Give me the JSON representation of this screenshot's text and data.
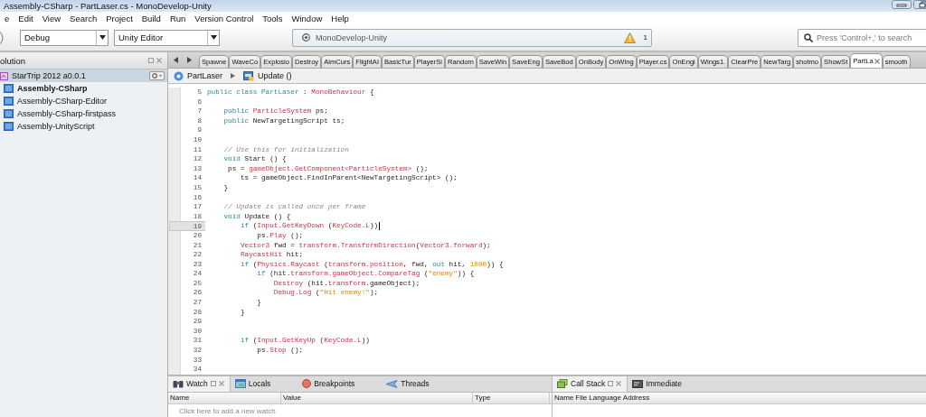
{
  "window": {
    "title": "Assembly-CSharp - PartLaser.cs - MonoDevelop-Unity"
  },
  "menu": [
    "e",
    "Edit",
    "View",
    "Search",
    "Project",
    "Build",
    "Run",
    "Version Control",
    "Tools",
    "Window",
    "Help"
  ],
  "toolbar": {
    "configuration": "Debug",
    "target": "Unity Editor",
    "status": "MonoDevelop-Unity",
    "warnings": "1",
    "search": {
      "placeholder": "Press 'Control+,' to search"
    }
  },
  "solution": {
    "title": "olution",
    "items": [
      {
        "label": "StarTrip 2012 a0.0.1",
        "selected": true,
        "startup": false,
        "children": [
          {
            "label": "Assembly-CSharp",
            "selected": false,
            "startup": true
          },
          {
            "label": "Assembly-CSharp-Editor",
            "selected": false,
            "startup": false
          },
          {
            "label": "Assembly-CSharp-firstpass",
            "selected": false,
            "startup": false
          },
          {
            "label": "Assembly-UnityScript",
            "selected": false,
            "startup": false
          }
        ]
      }
    ]
  },
  "tabs": [
    {
      "label": "Spawne",
      "selected": false
    },
    {
      "label": "WaveCo",
      "selected": false
    },
    {
      "label": "Explosio",
      "selected": false
    },
    {
      "label": "Destroy",
      "selected": false
    },
    {
      "label": "AimCurs",
      "selected": false
    },
    {
      "label": "FlightAI",
      "selected": false
    },
    {
      "label": "BasicTur",
      "selected": false
    },
    {
      "label": "PlayerSi",
      "selected": false
    },
    {
      "label": "Random",
      "selected": false
    },
    {
      "label": "SaveWin",
      "selected": false
    },
    {
      "label": "SaveEng",
      "selected": false
    },
    {
      "label": "SaveBod",
      "selected": false
    },
    {
      "label": "OnBody",
      "selected": false
    },
    {
      "label": "OnWing",
      "selected": false
    },
    {
      "label": "Player.cs",
      "selected": false
    },
    {
      "label": "OnEngi",
      "selected": false
    },
    {
      "label": "Wings1.",
      "selected": false
    },
    {
      "label": "ClearPre",
      "selected": false
    },
    {
      "label": "NewTarg",
      "selected": false
    },
    {
      "label": "shotmo",
      "selected": false
    },
    {
      "label": "ShowSt",
      "selected": false
    },
    {
      "label": "PartLa",
      "selected": true
    },
    {
      "label": "smooth",
      "selected": false
    }
  ],
  "breadcrumb": [
    {
      "kind": "class",
      "label": "PartLaser"
    },
    {
      "kind": "method",
      "label": "Update ()"
    }
  ],
  "editor": {
    "lines": [
      {
        "number": "5",
        "current": false,
        "tokens": [
          {
            "kind": "keyword",
            "text": "public class PartLaser"
          },
          {
            "kind": "plain",
            "text": " : "
          },
          {
            "kind": "type",
            "text": "MonoBehaviour"
          },
          {
            "kind": "plain",
            "text": " {"
          }
        ]
      },
      {
        "number": "6",
        "current": false
      },
      {
        "number": "7",
        "current": false,
        "tokens": [
          {
            "kind": "keyword",
            "text": "    public "
          },
          {
            "kind": "type",
            "text": "ParticleSystem"
          },
          {
            "kind": "plain",
            "text": " ps;"
          }
        ]
      },
      {
        "number": "8",
        "current": false,
        "tokens": [
          {
            "kind": "keyword",
            "text": "    public "
          },
          {
            "kind": "plain",
            "text": "NewTargetingScript ts;"
          }
        ]
      },
      {
        "number": "9",
        "current": false
      },
      {
        "number": "10",
        "current": false
      },
      {
        "number": "11",
        "current": false,
        "tokens": [
          {
            "kind": "comment",
            "text": "    // Use this for initialization"
          }
        ]
      },
      {
        "number": "12",
        "current": false,
        "tokens": [
          {
            "kind": "keyword",
            "text": "    void "
          },
          {
            "kind": "plain",
            "text": "Start () {"
          }
        ]
      },
      {
        "number": "13",
        "current": false,
        "tokens": [
          {
            "kind": "plain",
            "text": "     ps = "
          },
          {
            "kind": "type",
            "text": "gameObject.GetComponent<ParticleSystem>"
          },
          {
            "kind": "plain",
            "text": " ();"
          }
        ]
      },
      {
        "number": "14",
        "current": false,
        "tokens": [
          {
            "kind": "plain",
            "text": "        ts = gameObject.FindInParent<NewTargetingScript> ();"
          }
        ]
      },
      {
        "number": "15",
        "current": false,
        "tokens": [
          {
            "kind": "plain",
            "text": "    }"
          }
        ]
      },
      {
        "number": "16",
        "current": false
      },
      {
        "number": "17",
        "current": false,
        "tokens": [
          {
            "kind": "comment",
            "text": "    // Update is called once per frame"
          }
        ]
      },
      {
        "number": "18",
        "current": false,
        "tokens": [
          {
            "kind": "keyword",
            "text": "    void "
          },
          {
            "kind": "plain",
            "text": "Update () {"
          }
        ]
      },
      {
        "number": "19",
        "current": true,
        "tokens": [
          {
            "kind": "keyword",
            "text": "        if "
          },
          {
            "kind": "plain",
            "text": "("
          },
          {
            "kind": "type",
            "text": "Input.GetKeyDown"
          },
          {
            "kind": "plain",
            "text": " ("
          },
          {
            "kind": "type",
            "text": "KeyCode.L"
          },
          {
            "kind": "plain",
            "text": "))"
          }
        ]
      },
      {
        "number": "20",
        "current": false,
        "tokens": [
          {
            "kind": "plain",
            "text": "            ps."
          },
          {
            "kind": "type",
            "text": "Play"
          },
          {
            "kind": "plain",
            "text": " ();"
          }
        ]
      },
      {
        "number": "21",
        "current": false,
        "tokens": [
          {
            "kind": "type",
            "text": "        Vector3"
          },
          {
            "kind": "plain",
            "text": " fwd = "
          },
          {
            "kind": "type",
            "text": "transform.TransformDirection"
          },
          {
            "kind": "plain",
            "text": "("
          },
          {
            "kind": "type",
            "text": "Vector3.forward"
          },
          {
            "kind": "plain",
            "text": ");"
          }
        ]
      },
      {
        "number": "22",
        "current": false,
        "tokens": [
          {
            "kind": "type",
            "text": "        RaycastHit"
          },
          {
            "kind": "plain",
            "text": " hit;"
          }
        ]
      },
      {
        "number": "23",
        "current": false,
        "tokens": [
          {
            "kind": "keyword",
            "text": "        if "
          },
          {
            "kind": "plain",
            "text": "("
          },
          {
            "kind": "type",
            "text": "Physics.Raycast"
          },
          {
            "kind": "plain",
            "text": " ("
          },
          {
            "kind": "type",
            "text": "transform.position"
          },
          {
            "kind": "plain",
            "text": ", fwd, "
          },
          {
            "kind": "keyword",
            "text": "out "
          },
          {
            "kind": "plain",
            "text": "hit, "
          },
          {
            "kind": "number",
            "text": "1000"
          },
          {
            "kind": "plain",
            "text": ")) {"
          }
        ]
      },
      {
        "number": "24",
        "current": false,
        "tokens": [
          {
            "kind": "keyword",
            "text": "            if "
          },
          {
            "kind": "plain",
            "text": "(hit."
          },
          {
            "kind": "type",
            "text": "transform.gameObject.CompareTag"
          },
          {
            "kind": "plain",
            "text": " ("
          },
          {
            "kind": "string",
            "text": "\"enemy\""
          },
          {
            "kind": "plain",
            "text": ")) {"
          }
        ]
      },
      {
        "number": "25",
        "current": false,
        "tokens": [
          {
            "kind": "type",
            "text": "                Destroy"
          },
          {
            "kind": "plain",
            "text": " (hit."
          },
          {
            "kind": "type",
            "text": "transform"
          },
          {
            "kind": "plain",
            "text": ".gameObject);"
          }
        ]
      },
      {
        "number": "26",
        "current": false,
        "tokens": [
          {
            "kind": "type",
            "text": "                Debug.Log"
          },
          {
            "kind": "plain",
            "text": " ("
          },
          {
            "kind": "string",
            "text": "\"Hit enemy!\""
          },
          {
            "kind": "plain",
            "text": ");"
          }
        ]
      },
      {
        "number": "27",
        "current": false,
        "tokens": [
          {
            "kind": "plain",
            "text": "            }"
          }
        ]
      },
      {
        "number": "28",
        "current": false,
        "tokens": [
          {
            "kind": "plain",
            "text": "        }"
          }
        ]
      },
      {
        "number": "29",
        "current": false
      },
      {
        "number": "30",
        "current": false
      },
      {
        "number": "31",
        "current": false,
        "tokens": [
          {
            "kind": "keyword",
            "text": "        if "
          },
          {
            "kind": "plain",
            "text": "("
          },
          {
            "kind": "type",
            "text": "Input.GetKeyUp"
          },
          {
            "kind": "plain",
            "text": " ("
          },
          {
            "kind": "type",
            "text": "KeyCode.L"
          },
          {
            "kind": "plain",
            "text": "))"
          }
        ]
      },
      {
        "number": "32",
        "current": false,
        "tokens": [
          {
            "kind": "plain",
            "text": "            ps."
          },
          {
            "kind": "type",
            "text": "Stop"
          },
          {
            "kind": "plain",
            "text": " ();"
          }
        ]
      },
      {
        "number": "33",
        "current": false
      },
      {
        "number": "34",
        "current": false
      }
    ]
  },
  "watch": {
    "tabs": [
      {
        "kind": "watch",
        "label": "Watch",
        "selected": true
      },
      {
        "kind": "locals",
        "label": "Locals",
        "selected": false
      },
      {
        "kind": "breakpoints",
        "label": "Breakpoints",
        "selected": false
      },
      {
        "kind": "threads",
        "label": "Threads",
        "selected": false
      }
    ],
    "columns": [
      "Name",
      "Value",
      "Type"
    ],
    "hint_row": "Click here to add a new watch"
  },
  "callstack": {
    "tabs": [
      {
        "kind": "callstack",
        "label": "Call Stack",
        "selected": true
      },
      {
        "kind": "immediate",
        "label": "Immediate",
        "selected": false
      }
    ],
    "columns": [
      "Name",
      "File",
      "Language",
      "Address"
    ]
  }
}
